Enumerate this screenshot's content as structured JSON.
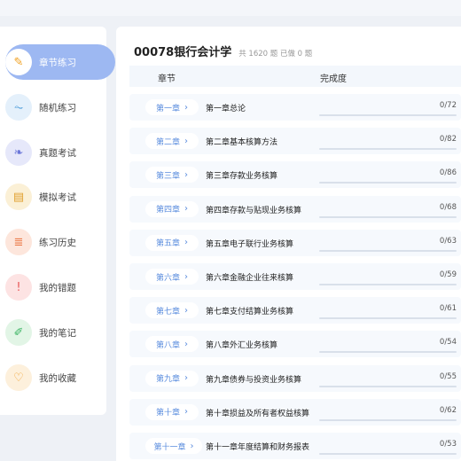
{
  "sidebar": {
    "items": [
      {
        "label": "章节练习",
        "icon": "pen-icon",
        "glyph": "✎",
        "bg": "#ffffff",
        "fg": "#f0a020",
        "active": true
      },
      {
        "label": "随机练习",
        "icon": "pulse-icon",
        "glyph": "⏦",
        "bg": "#e4f0fb",
        "fg": "#4a9ad8",
        "active": false
      },
      {
        "label": "真题考试",
        "icon": "book-icon",
        "glyph": "❧",
        "bg": "#e6e8fa",
        "fg": "#6a76d8",
        "active": false
      },
      {
        "label": "模拟考试",
        "icon": "document-icon",
        "glyph": "▤",
        "bg": "#fbf0d6",
        "fg": "#e0a030",
        "active": false
      },
      {
        "label": "练习历史",
        "icon": "list-icon",
        "glyph": "≣",
        "bg": "#fde6dc",
        "fg": "#ec7a4a",
        "active": false
      },
      {
        "label": "我的错题",
        "icon": "alert-icon",
        "glyph": "!",
        "bg": "#fde3e3",
        "fg": "#e85a5a",
        "active": false
      },
      {
        "label": "我的笔记",
        "icon": "edit-icon",
        "glyph": "✐",
        "bg": "#e2f5e6",
        "fg": "#3cb464",
        "active": false
      },
      {
        "label": "我的收藏",
        "icon": "heart-icon",
        "glyph": "♡",
        "bg": "#fdf0dc",
        "fg": "#f0a030",
        "active": false
      }
    ]
  },
  "header": {
    "title": "00078银行会计学",
    "stats": "共 1620 题 已做 0 题"
  },
  "table": {
    "col_chapter": "章节",
    "col_progress": "完成度",
    "rows": [
      {
        "pill": "第一章",
        "title": "第一章总论",
        "done": 0,
        "total": 72,
        "count": "0/72"
      },
      {
        "pill": "第二章",
        "title": "第二章基本核算方法",
        "done": 0,
        "total": 82,
        "count": "0/82"
      },
      {
        "pill": "第三章",
        "title": "第三章存款业务核算",
        "done": 0,
        "total": 86,
        "count": "0/86"
      },
      {
        "pill": "第四章",
        "title": "第四章存款与贴现业务核算",
        "done": 0,
        "total": 68,
        "count": "0/68"
      },
      {
        "pill": "第五章",
        "title": "第五章电子联行业务核算",
        "done": 0,
        "total": 63,
        "count": "0/63"
      },
      {
        "pill": "第六章",
        "title": "第六章金融企业往来核算",
        "done": 0,
        "total": 59,
        "count": "0/59"
      },
      {
        "pill": "第七章",
        "title": "第七章支付结算业务核算",
        "done": 0,
        "total": 61,
        "count": "0/61"
      },
      {
        "pill": "第八章",
        "title": "第八章外汇业务核算",
        "done": 0,
        "total": 54,
        "count": "0/54"
      },
      {
        "pill": "第九章",
        "title": "第九章债券与投资业务核算",
        "done": 0,
        "total": 55,
        "count": "0/55"
      },
      {
        "pill": "第十章",
        "title": "第十章损益及所有者权益核算",
        "done": 0,
        "total": 62,
        "count": "0/62"
      },
      {
        "pill": "第十一章",
        "title": "第十一章年度结算和财务报表",
        "done": 0,
        "total": 53,
        "count": "0/53"
      }
    ]
  },
  "colors": {
    "accent": "#5a8cde",
    "active_nav": "#9db8f2"
  }
}
